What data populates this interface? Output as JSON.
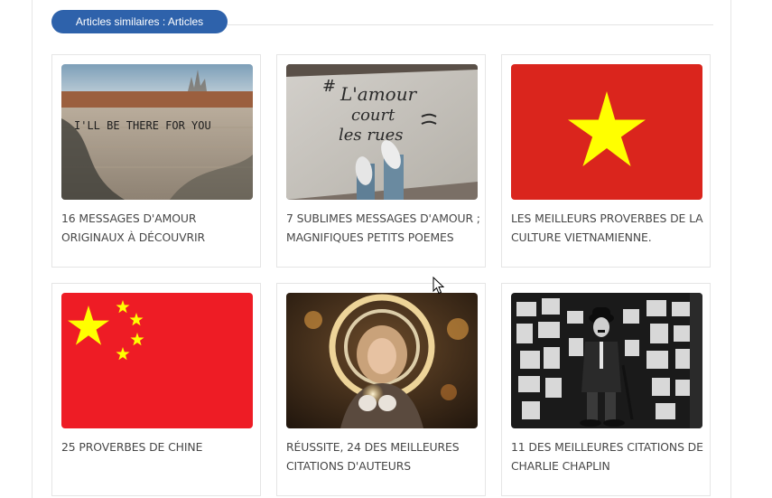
{
  "section": {
    "title": "Articles similaires : Articles"
  },
  "articles": [
    {
      "title": "16 MESSAGES D'AMOUR ORIGINAUX À DÉCOUVRIR",
      "image": "wall-graffiti-photo",
      "image_text": "I'LL BE THERE FOR YOU"
    },
    {
      "title": "7 SUBLIMES MESSAGES D'AMOUR ; MAGNIFIQUES PETITS POEMES",
      "image": "street-writing-photo",
      "image_text_1": "#",
      "image_text_2": "L'amour",
      "image_text_3": "court",
      "image_text_4": "les rues"
    },
    {
      "title": "LES MEILLEURS PROVERBES DE LA CULTURE VIETNAMIENNE.",
      "image": "vietnam-flag"
    },
    {
      "title": "25 PROVERBES DE CHINE",
      "image": "china-flag"
    },
    {
      "title": "RÉUSSITE, 24 DES MEILLEURES CITATIONS D'AUTEURS",
      "image": "sparkler-girl-photo"
    },
    {
      "title": "11 DES MEILLEURES CITATIONS DE CHARLIE CHAPLIN",
      "image": "charlie-chaplin-photo"
    }
  ],
  "colors": {
    "accent": "#2e62ab",
    "title_text": "#474747",
    "vietnam_red": "#da251d",
    "china_red": "#ee1c25",
    "flag_yellow": "#ffff00"
  }
}
